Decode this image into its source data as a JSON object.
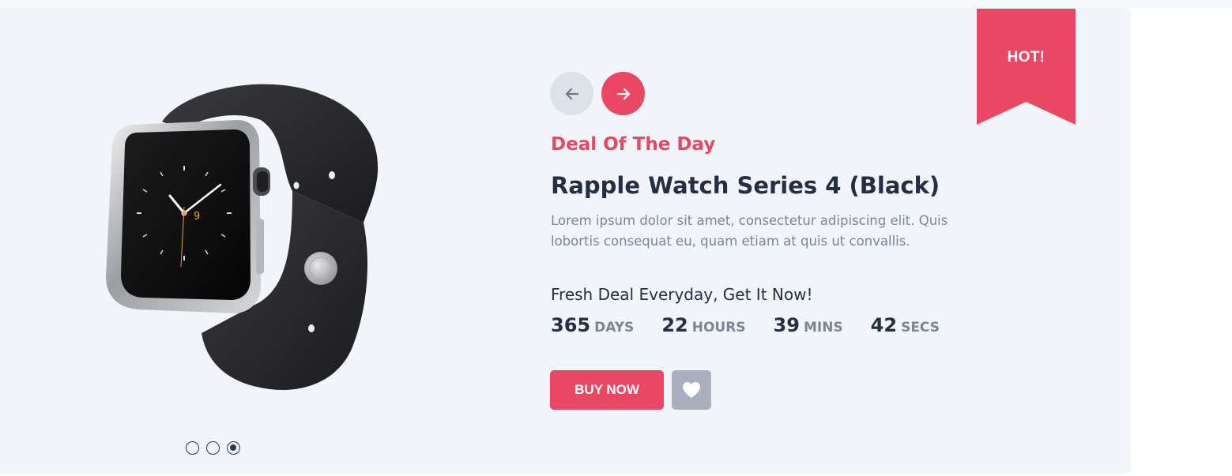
{
  "ribbon": {
    "label": "HOT!"
  },
  "nav": {
    "prev_icon": "arrow-left-icon",
    "next_icon": "arrow-right-icon"
  },
  "product": {
    "eyebrow": "Deal Of The Day",
    "title": "Rapple Watch Series 4 (Black)",
    "description": "Lorem ipsum dolor sit amet, consectetur adipiscing elit. Quis lobortis consequat eu, quam etiam at quis ut convallis.",
    "watch_face_number": "9"
  },
  "deal": {
    "headline": "Fresh Deal Everyday, Get It Now!",
    "countdown": [
      {
        "value": "365",
        "unit": "DAYS"
      },
      {
        "value": "22",
        "unit": "HOURS"
      },
      {
        "value": "39",
        "unit": "MINS"
      },
      {
        "value": "42",
        "unit": "SECS"
      }
    ]
  },
  "actions": {
    "buy_label": "BUY NOW",
    "wishlist_icon": "heart-icon"
  },
  "slider": {
    "count": 3,
    "active_index": 2
  },
  "colors": {
    "accent": "#ea4763",
    "heading": "#242f44",
    "muted": "#7c8595",
    "card_bg": "#f1f4f8",
    "dot": "#25365c",
    "wishlist_bg": "#a9b0bb",
    "prev_bg": "#dde2e9"
  }
}
